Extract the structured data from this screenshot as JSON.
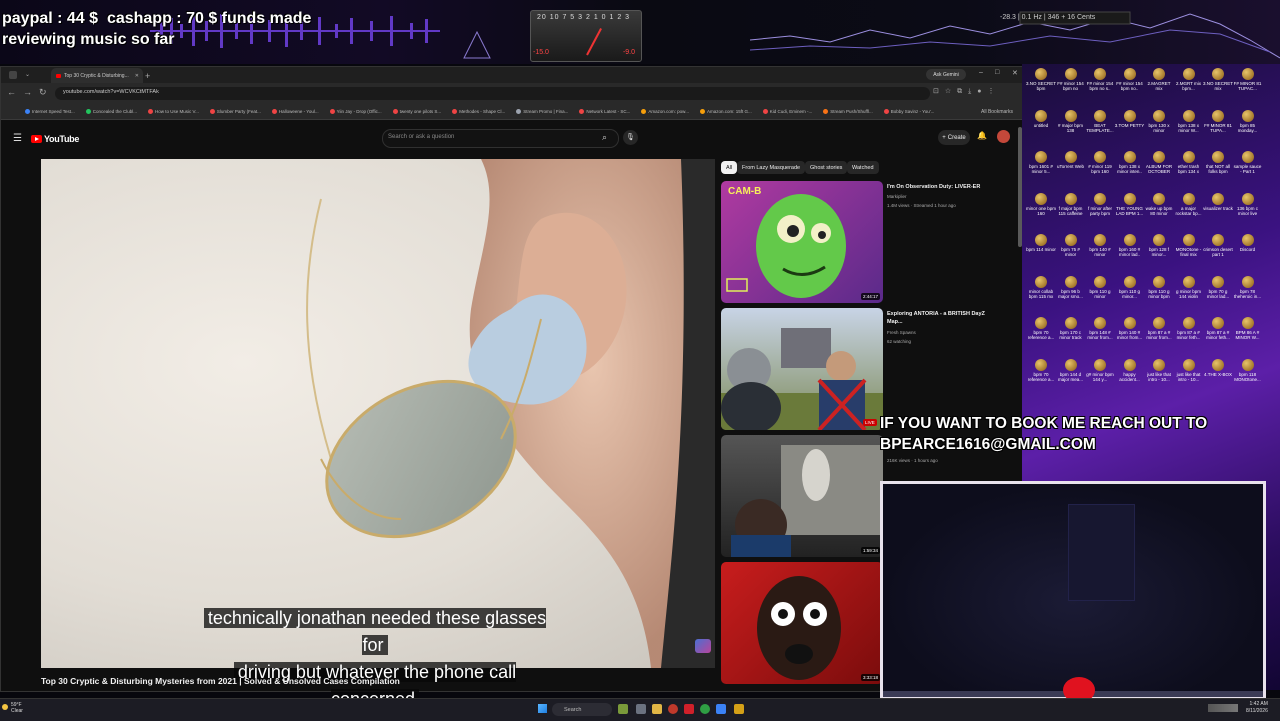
{
  "overlay": {
    "funds_text": "paypal : 44 $  cashapp : 70 $ funds made\nreviewing music so far",
    "meter_scale": "20 10 7 5 3 2 1 0 1 2 3",
    "meter_left": "-15.0",
    "meter_right": "-9.0",
    "spectrum_readout": "-28.3 | 0.1 Hz | 346 + 16 Cents",
    "bookme_text": "IF YOU WANT TO BOOK ME REACH OUT TO\nBPEARCE1616@GMAIL.COM"
  },
  "browser": {
    "active_tab": "Top 30 Cryptic & Disturbing...",
    "ask_gemini": "Ask Gemini",
    "url": "youtube.com/watch?v=WCVKCtMTFAk",
    "all_bookmarks": "All Bookmarks",
    "bookmarks": [
      {
        "label": "Internet Speed Test...",
        "color": "#3b82f6"
      },
      {
        "label": "Concealed the Clubl...",
        "color": "#22c55e"
      },
      {
        "label": "How to Use Music V...",
        "color": "#ef4444"
      },
      {
        "label": "Slumber Party (Feat...",
        "color": "#ef4444"
      },
      {
        "label": "Halloweene - Youl...",
        "color": "#ef4444"
      },
      {
        "label": "Yiin Jay - Drop (Offic...",
        "color": "#ef4444"
      },
      {
        "label": "twenty one pilots S...",
        "color": "#ef4444"
      },
      {
        "label": "Methodes - Shape Cl...",
        "color": "#ef4444"
      },
      {
        "label": "Stream Promo | Fina...",
        "color": "#9ca3af"
      },
      {
        "label": "Network Latest - SC...",
        "color": "#ef4444"
      },
      {
        "label": "Amazon.com: pow...",
        "color": "#f59e0b"
      },
      {
        "label": "Amazon.com: 15ft G...",
        "color": "#f59e0b"
      },
      {
        "label": "Kid Cudi, Eminem -...",
        "color": "#ef4444"
      },
      {
        "label": "Stream Push/Shuffl...",
        "color": "#f97316"
      },
      {
        "label": "Bobby Savinz - You'...",
        "color": "#ef4444"
      }
    ]
  },
  "youtube": {
    "logo_text": "YouTube",
    "search_placeholder": "Search or ask a question",
    "create_label": "Create",
    "subtitle_line1": "technically jonathan needed these glasses for",
    "subtitle_line2": "driving but whatever the phone call concerned",
    "video_title": "Top 30 Cryptic & Disturbing Mysteries from 2021 | Solved & Unsolved Cases Compilation",
    "chips": [
      "All",
      "From Lazy Masquerade",
      "Ghost stories",
      "Watched"
    ],
    "recs": [
      {
        "title": "I'm On Observation Duty: LIVER-ER",
        "channel": "Markiplier",
        "meta": "1.4M views · Streamed 1 hour ago",
        "duration": "2:44:17",
        "thumb_text": "CAM-B"
      },
      {
        "title": "Exploring ANTORIA - a BRITISH DayZ Map...",
        "channel": "Fresh Spawns",
        "meta": "62 watching",
        "duration": "LIVE"
      },
      {
        "title": "",
        "channel": "",
        "meta": "216K views · 1 hours ago",
        "duration": "1:59:34"
      },
      {
        "title": "",
        "channel": "",
        "meta": "",
        "duration": "3:33:18"
      }
    ]
  },
  "desktop": {
    "icons": [
      "3.NO SECRET bpm",
      "F# minor 154 bpm no",
      "F# minor 154 bpm no s..",
      "F# minor 154 bpm no..",
      "2.MAGRET mix",
      "2.MGRT mix bpm...",
      "3.NO SECRET mix",
      "F# MINOR 81 TUPAC...",
      "untitled",
      "# major bpm 138",
      "BEAT TEMPLATE...",
      "3.TOM PETTY",
      "bpm 130 x minor",
      "bpm 138 x minor W...",
      "F# MINOR 81 TUPA...",
      "bpm 85 monday...",
      "bpm 1601 # minor 5...",
      "uTorrent Web",
      "# minor 119 bpm 160",
      "bpm 138 x minor inten..",
      "ALBUM FOR OCTOBER",
      "ether trash bpm 134 x",
      "that NOT all folks bpm",
      "sample sauce - Part 1",
      "minor one bpm 160",
      "f major bpm 115 caffeine",
      "f minor after party bpm",
      "THE YOUNG LAD BPM 1...",
      "wake up bpm 80 minor",
      "a major rockstar bp...",
      "visualizer track",
      "136 bpm c minor live",
      "bpm 114 minor",
      "bpm 75 # minor",
      "bpm 140 # minor",
      "bpm 160 # minor lad..",
      "bpm 128 f minor...",
      "MONOtone - final mix",
      "crimson desert part 1",
      "Discord",
      "minor collab bpm 115 mx",
      "bpm 96 b major smo...",
      "bpm 110 g minor",
      "bpm 110 g minor...",
      "bpm 110 g minor bpm",
      "g minor bpm 144 violin",
      "bpm 70 g minor lad...",
      "bpm 78 theheroic in...",
      "bpm 70 reference a...",
      "bpm 170 c minor track",
      "bpm 148 # minor from...",
      "bpm 140 # minor from...",
      "bpm 87 a # minor from...",
      "bpm 87 a # minor feth...",
      "bpm 87 a # minor feth...",
      "BPM 86 A # MINOR W...",
      "bpm 70 reference a...",
      "bpm 144 d major mea...",
      "g# minor bpm 144 y...",
      "happy accident...",
      "just like that intro - 10...",
      "just like that intro - 10...",
      "4.THE X-BOX",
      "bpm 118 MONOtone..."
    ]
  },
  "taskbar": {
    "weather": "59°F\nClear",
    "search": "Search",
    "clock": "1:42 AM\n8/11/2026"
  }
}
